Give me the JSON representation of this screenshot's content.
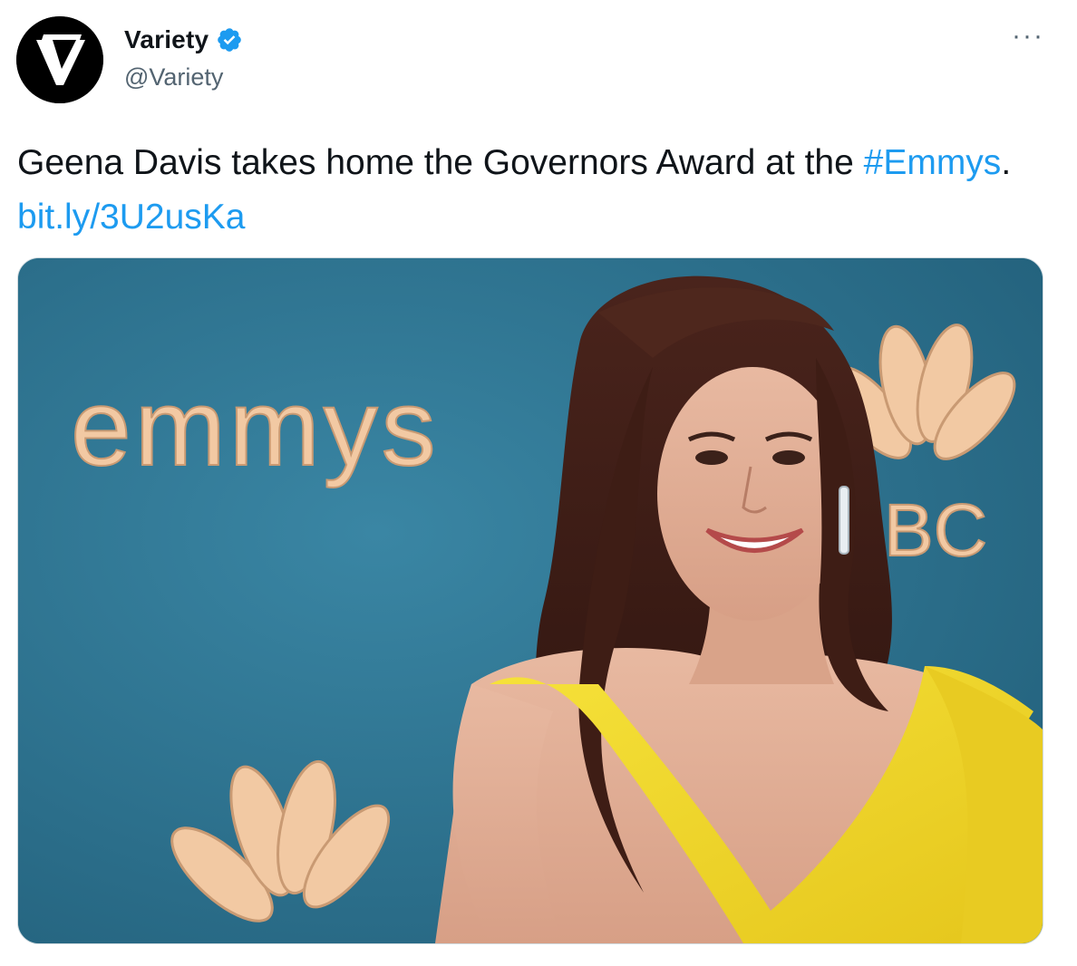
{
  "author": {
    "display_name": "Variety",
    "handle": "@Variety",
    "verified": true,
    "avatar_icon": "variety-v-logo"
  },
  "tweet": {
    "text_main": "Geena Davis takes home the Governors Award at the ",
    "hashtag": "#Emmys",
    "separator": ". ",
    "link": "bit.ly/3U2usKa"
  },
  "menu": {
    "more_label": "···"
  },
  "media": {
    "backdrop_text": "emmys",
    "partial_logo_text": "BC",
    "backdrop_color": "#2f7896",
    "dress_color": "#f3dc2e",
    "accent_color": "#1d9bf0"
  }
}
